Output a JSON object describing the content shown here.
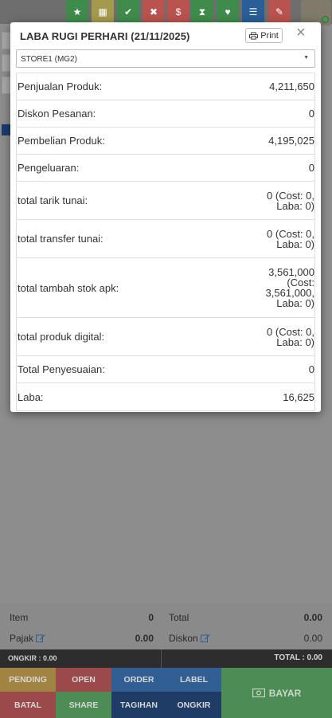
{
  "topbar": {
    "buttons": [
      {
        "icon": "star-icon",
        "glyph": "★",
        "color": "#3f8b4b"
      },
      {
        "icon": "grid-icon",
        "glyph": "▦",
        "color": "#a39a4c"
      },
      {
        "icon": "check-circle-icon",
        "glyph": "✔",
        "color": "#3f8b4b"
      },
      {
        "icon": "x-circle-icon",
        "glyph": "✖",
        "color": "#b9534f"
      },
      {
        "icon": "dollar-icon",
        "glyph": "$",
        "color": "#b9534f"
      },
      {
        "icon": "hourglass-icon",
        "glyph": "⧗",
        "color": "#3f8b4b"
      },
      {
        "icon": "heart-icon",
        "glyph": "♥",
        "color": "#3f8b4b"
      },
      {
        "icon": "list-icon",
        "glyph": "☰",
        "color": "#2a5e96"
      },
      {
        "icon": "eraser-icon",
        "glyph": "✎",
        "color": "#b9534f"
      }
    ]
  },
  "modal": {
    "title": "LABA RUGI PERHARI (21/11/2025)",
    "print_label": "Print",
    "close_label": "×",
    "store_select": "STORE1 (MG2)",
    "rows": [
      {
        "label": "Penjualan Produk:",
        "value": "4,211,650"
      },
      {
        "label": "Diskon Pesanan:",
        "value": "0"
      },
      {
        "label": "Pembelian Produk:",
        "value": "4,195,025"
      },
      {
        "label": "Pengeluaran:",
        "value": "0"
      },
      {
        "label": "total tarik tunai:",
        "value": "0 (Cost: 0, Laba: 0)"
      },
      {
        "label": "total transfer tunai:",
        "value": "0 (Cost: 0, Laba: 0)"
      },
      {
        "label": "total tambah stok apk:",
        "value": "3,561,000 (Cost: 3,561,000, Laba: 0)"
      },
      {
        "label": "total produk digital:",
        "value": "0 (Cost: 0, Laba: 0)"
      },
      {
        "label": "Total Penyesuaian:",
        "value": "0"
      },
      {
        "label": "Laba:",
        "value": "16,625"
      }
    ]
  },
  "summary": {
    "item_label": "Item",
    "item_value": "0",
    "total_label": "Total",
    "total_value": "0.00",
    "pajak_label": "Pajak",
    "pajak_value": "0.00",
    "diskon_label": "Diskon",
    "diskon_value": "0.00"
  },
  "status": {
    "ongkir": "ONGKIR : 0.00",
    "total": "TOTAL : 0.00"
  },
  "actions": {
    "pending": "PENDING",
    "open": "OPEN",
    "order": "ORDER",
    "label": "LABEL",
    "batal": "BATAL",
    "share": "SHARE",
    "tagihan": "TAGIHAN",
    "ongkir": "ONGKIR",
    "bayar": "BAYAR"
  },
  "colors": {
    "pending": "#a28442",
    "open": "#9a4b49",
    "order": "#315f94",
    "label": "#315f94",
    "batal": "#9a4b49",
    "share": "#4d8d55",
    "tagihan": "#1f3c66",
    "ongkir": "#1f3c66"
  }
}
